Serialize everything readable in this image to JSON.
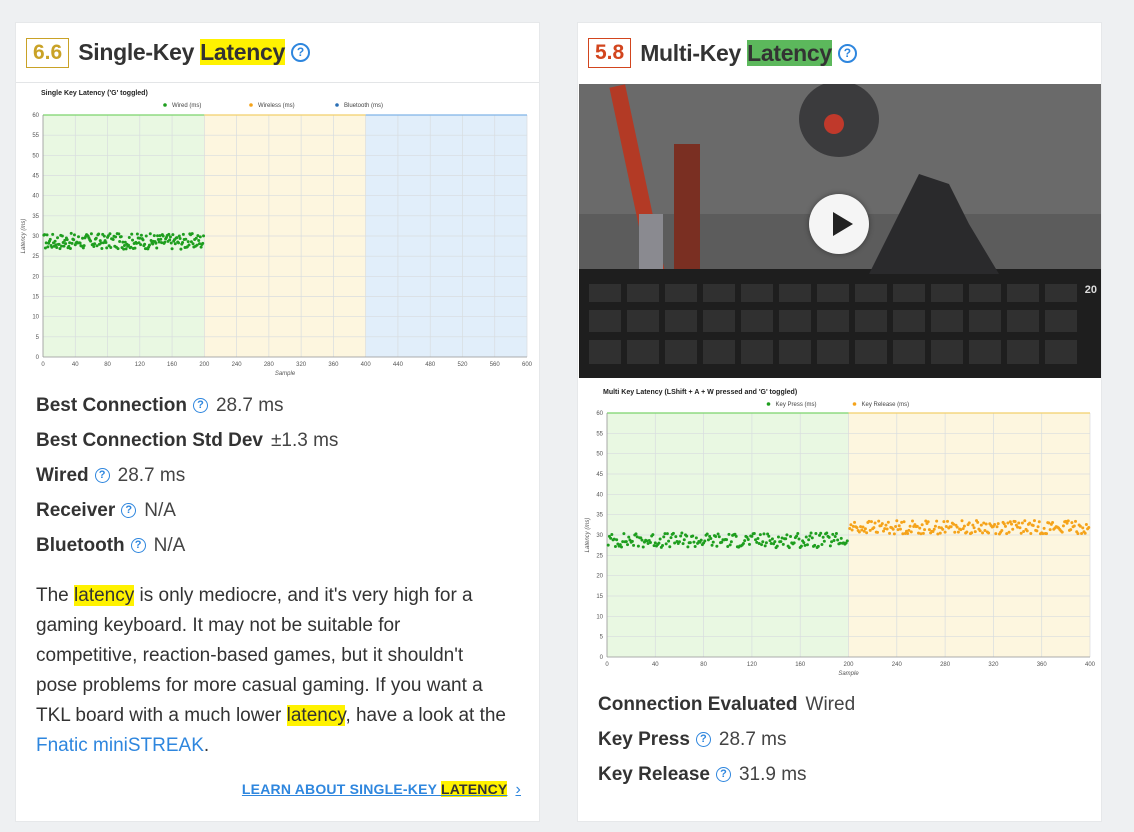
{
  "left": {
    "score": "6.6",
    "score_color": "#c9a227",
    "title_prefix": "Single-Key ",
    "title_highlight": "Latency",
    "metrics": [
      {
        "label": "Best Connection",
        "help": true,
        "value": "28.7 ms"
      },
      {
        "label": "Best Connection Std Dev",
        "help": false,
        "value": "±1.3 ms"
      },
      {
        "label": "Wired",
        "help": true,
        "value": "28.7 ms"
      },
      {
        "label": "Receiver",
        "help": true,
        "value": "N/A"
      },
      {
        "label": "Bluetooth",
        "help": true,
        "value": "N/A"
      }
    ],
    "para": {
      "p1": "The ",
      "hl1": "latency",
      "p2": " is only mediocre, and it's very high for a gaming keyboard. It may not be suitable for competitive, reaction-based games, but it shouldn't pose problems for more casual gaming. If you want a TKL board with a much lower ",
      "hl2": "latency",
      "p3": ", have a look at the ",
      "link": "Fnatic miniSTREAK",
      "p4": "."
    },
    "learn_prefix": "LEARN ABOUT SINGLE-KEY ",
    "learn_highlight": "LATENCY",
    "learn_chevron": "›"
  },
  "right": {
    "score": "5.8",
    "score_color": "#d2451e",
    "title_prefix": "Multi-Key ",
    "title_highlight": "Latency",
    "video_icon": "play-icon",
    "video_timestamp": "20",
    "metrics": [
      {
        "label": "Connection Evaluated",
        "help": false,
        "value": "Wired"
      },
      {
        "label": "Key Press",
        "help": true,
        "value": "28.7 ms"
      },
      {
        "label": "Key Release",
        "help": true,
        "value": "31.9 ms"
      }
    ]
  },
  "help_glyph": "?",
  "chart_data": [
    {
      "type": "scatter",
      "title": "Single Key Latency ('G' toggled)",
      "xlabel": "Sample",
      "ylabel": "Latency (ms)",
      "xlim": [
        0,
        600
      ],
      "ylim": [
        0,
        60
      ],
      "xticks": [
        0,
        40,
        80,
        120,
        160,
        200,
        240,
        280,
        320,
        360,
        400,
        440,
        480,
        520,
        560,
        600
      ],
      "yticks": [
        0,
        5,
        10,
        15,
        20,
        25,
        30,
        35,
        40,
        45,
        50,
        55,
        60
      ],
      "legend": "top",
      "grid": true,
      "regions": [
        {
          "from": 0,
          "to": 200,
          "color": "#e9f8e2"
        },
        {
          "from": 200,
          "to": 400,
          "color": "#fdf6df"
        },
        {
          "from": 400,
          "to": 600,
          "color": "#e1eefa"
        }
      ],
      "series": [
        {
          "name": "Wired (ms)",
          "color": "#1e9e1e",
          "x_range": [
            0,
            200
          ],
          "mean": 28.7,
          "spread": 1.3
        },
        {
          "name": "Wireless (ms)",
          "color": "#f5a31a",
          "x_range": null
        },
        {
          "name": "Bluetooth (ms)",
          "color": "#2a6fb5",
          "x_range": null
        }
      ]
    },
    {
      "type": "scatter",
      "title": "Multi Key Latency (LShift + A + W pressed and 'G' toggled)",
      "xlabel": "Sample",
      "ylabel": "Latency (ms)",
      "xlim": [
        0,
        400
      ],
      "ylim": [
        0,
        60
      ],
      "xticks": [
        0,
        40,
        80,
        120,
        160,
        200,
        240,
        280,
        320,
        360,
        400
      ],
      "yticks": [
        0,
        5,
        10,
        15,
        20,
        25,
        30,
        35,
        40,
        45,
        50,
        55,
        60
      ],
      "legend": "top",
      "grid": true,
      "regions": [
        {
          "from": 0,
          "to": 200,
          "color": "#e9f8e2"
        },
        {
          "from": 200,
          "to": 400,
          "color": "#fdf6df"
        }
      ],
      "series": [
        {
          "name": "Key Press (ms)",
          "color": "#1e9e1e",
          "x_range": [
            0,
            200
          ],
          "mean": 28.7,
          "spread": 1.2
        },
        {
          "name": "Key Release (ms)",
          "color": "#f5a31a",
          "x_range": [
            200,
            400
          ],
          "mean": 31.9,
          "spread": 1.1
        }
      ]
    }
  ]
}
